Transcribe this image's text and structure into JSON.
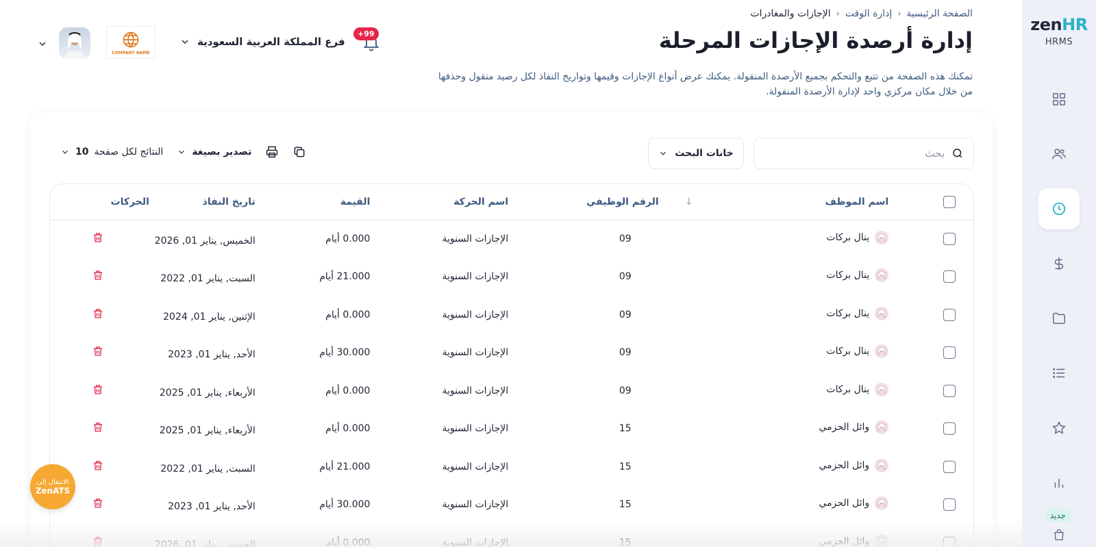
{
  "sidebar": {
    "brand_main": "zen",
    "brand_accent": "HR",
    "brand_sub": "HRMS",
    "new_label": "جديد",
    "items": [
      {
        "name": "dashboard-icon"
      },
      {
        "name": "users-icon"
      },
      {
        "name": "clock-icon",
        "active": true
      },
      {
        "name": "dollar-icon"
      },
      {
        "name": "folder-icon"
      },
      {
        "name": "list-icon"
      },
      {
        "name": "star-icon"
      },
      {
        "name": "bar-chart-icon"
      }
    ]
  },
  "breadcrumb": {
    "home": "الصفحة الرئيسية",
    "section": "إدارة الوقت",
    "current": "الإجازات والمغادرات"
  },
  "header": {
    "title": "إدارة أرصدة الإجازات المرحلة",
    "description": "تمكنك هذه الصفحة من تتبع والتحكم بجميع الأرصدة المنقولة. يمكنك عرض أنواع الإجازات وقيمها وتواريخ النفاذ لكل رصيد منقول وحذفها من خلال مكان مركزي واحد لإدارة الأرصدة المنقولة.",
    "notifications": "+99",
    "branch": "فرع المملكة العربية السعودية",
    "company_name": "COMPANY NAME"
  },
  "toolbar": {
    "search_placeholder": "بحث",
    "search_fields_label": "خانات البحث",
    "export_label": "تصدير بصيغة",
    "per_page_label": "النتائج لكل صفحة",
    "per_page_value": "10"
  },
  "table": {
    "columns": {
      "employee": "اسم الموظف",
      "employee_id": "الرقم الوظيفي",
      "transaction": "اسم الحركة",
      "value": "القيمة",
      "effective_date": "تاريخ النفاذ",
      "actions": "الحركات"
    },
    "rows": [
      {
        "employee": "ينال بركات",
        "id": "09",
        "transaction": "الإجازات السنوية",
        "value": "0.000 أيام",
        "date": "الخميس, يناير 01, 2026"
      },
      {
        "employee": "ينال بركات",
        "id": "09",
        "transaction": "الإجازات السنوية",
        "value": "21.000 أيام",
        "date": "السبت, يناير 01, 2022"
      },
      {
        "employee": "ينال بركات",
        "id": "09",
        "transaction": "الإجازات السنوية",
        "value": "0.000 أيام",
        "date": "الإثنين, يناير 01, 2024"
      },
      {
        "employee": "ينال بركات",
        "id": "09",
        "transaction": "الإجازات السنوية",
        "value": "30.000 أيام",
        "date": "الأحد, يناير 01, 2023"
      },
      {
        "employee": "ينال بركات",
        "id": "09",
        "transaction": "الإجازات السنوية",
        "value": "0.000 أيام",
        "date": "الأربعاء, يناير 01, 2025"
      },
      {
        "employee": "وائل الحزمي",
        "id": "15",
        "transaction": "الإجازات السنوية",
        "value": "0.000 أيام",
        "date": "الأربعاء, يناير 01, 2025"
      },
      {
        "employee": "وائل الحزمي",
        "id": "15",
        "transaction": "الإجازات السنوية",
        "value": "21.000 أيام",
        "date": "السبت, يناير 01, 2022"
      },
      {
        "employee": "وائل الحزمي",
        "id": "15",
        "transaction": "الإجازات السنوية",
        "value": "30.000 أيام",
        "date": "الأحد, يناير 01, 2023"
      },
      {
        "employee": "وائل الحزمي",
        "id": "15",
        "transaction": "الإجازات السنوية",
        "value": "0.000 أيام",
        "date": "الخميس, يناير 01, 2026"
      }
    ]
  },
  "zenats": {
    "line1": "الانتقال إلى",
    "line2": "ZenATS"
  },
  "colors": {
    "accent": "#2bb3c6",
    "delete": "#e5264a",
    "zenats": "#f7a832"
  }
}
